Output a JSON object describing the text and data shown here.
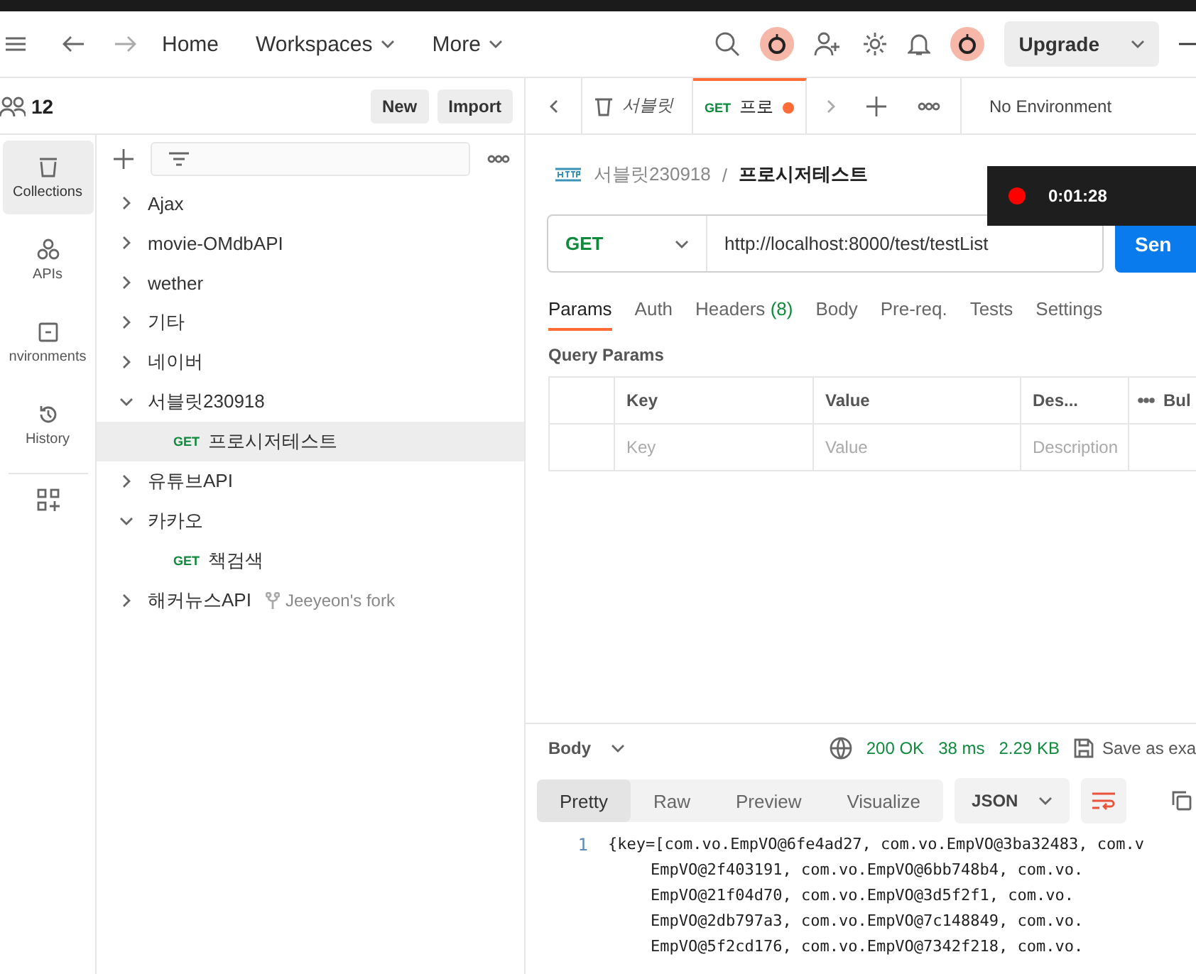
{
  "header": {
    "nav": [
      {
        "label": "Home",
        "dropdown": false
      },
      {
        "label": "Workspaces",
        "dropdown": true
      },
      {
        "label": "More",
        "dropdown": true
      }
    ],
    "upgrade": "Upgrade"
  },
  "workspace": {
    "count": "12",
    "buttons": [
      "New",
      "Import"
    ]
  },
  "tabs": [
    {
      "label": "서블릿",
      "kind": "preview",
      "selected": false
    },
    {
      "method": "GET",
      "label": "프로",
      "kind": "request",
      "selected": true,
      "unsaved": true
    }
  ],
  "environment": "No Environment",
  "rail": [
    {
      "label": "Collections",
      "kind": "collections",
      "selected": true
    },
    {
      "label": "APIs",
      "kind": "apis",
      "selected": false
    },
    {
      "label": "nvironments",
      "kind": "environments",
      "selected": false
    },
    {
      "label": "History",
      "kind": "history",
      "selected": false
    }
  ],
  "collections": [
    {
      "name": "Ajax",
      "expanded": false
    },
    {
      "name": "movie-OMdbAPI",
      "expanded": false
    },
    {
      "name": "wether",
      "expanded": false
    },
    {
      "name": "기타",
      "expanded": false
    },
    {
      "name": "네이버",
      "expanded": false
    },
    {
      "name": "서블릿230918",
      "expanded": true,
      "children": [
        {
          "method": "GET",
          "name": "프로시저테스트",
          "selected": true
        }
      ]
    },
    {
      "name": "유튜브API",
      "expanded": false
    },
    {
      "name": "카카오",
      "expanded": true,
      "children": [
        {
          "method": "GET",
          "name": "책검색",
          "selected": false
        }
      ]
    },
    {
      "name": "해커뉴스API",
      "expanded": false,
      "fork": "Jeeyeon's fork"
    }
  ],
  "request": {
    "breadcrumb": [
      "서블릿230918",
      "/",
      "프로시저테스트"
    ],
    "method": "GET",
    "url": "http://localhost:8000/test/testList",
    "send": "Sen",
    "tabs": [
      {
        "label": "Params",
        "selected": true
      },
      {
        "label": "Auth",
        "selected": false
      },
      {
        "label": "Headers",
        "count": "(8)",
        "selected": false
      },
      {
        "label": "Body",
        "selected": false
      },
      {
        "label": "Pre-req.",
        "selected": false
      },
      {
        "label": "Tests",
        "selected": false
      },
      {
        "label": "Settings",
        "selected": false
      }
    ],
    "query_title": "Query Params",
    "columns": [
      "Key",
      "Value",
      "Des...",
      "Bul"
    ],
    "placeholders": [
      "Key",
      "Value",
      "Description"
    ]
  },
  "response": {
    "section": "Body",
    "status": "200 OK",
    "time": "38 ms",
    "size": "2.29 KB",
    "save": "Save as exa",
    "views": [
      {
        "label": "Pretty",
        "selected": true
      },
      {
        "label": "Raw",
        "selected": false
      },
      {
        "label": "Preview",
        "selected": false
      },
      {
        "label": "Visualize",
        "selected": false
      }
    ],
    "format": "JSON",
    "line_number": "1",
    "lines": [
      "{key=[com.vo.EmpVO@6fe4ad27, com.vo.EmpVO@3ba32483, com.v",
      "EmpVO@2f403191, com.vo.EmpVO@6bb748b4, com.vo.",
      "EmpVO@21f04d70, com.vo.EmpVO@3d5f2f1, com.vo.",
      "EmpVO@2db797a3, com.vo.EmpVO@7c148849, com.vo.",
      "EmpVO@5f2cd176, com.vo.EmpVO@7342f218, com.vo."
    ]
  },
  "recording": {
    "time": "0:01:28"
  }
}
